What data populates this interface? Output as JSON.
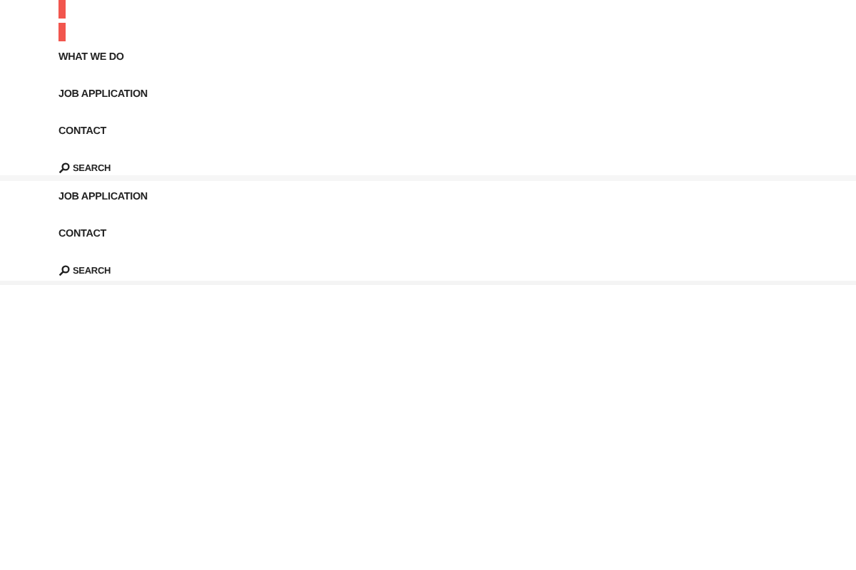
{
  "menus": [
    {
      "items": [
        "WHAT WE DO",
        "JOB APPLICATION",
        "CONTACT"
      ],
      "search": "SEARCH",
      "accent": true
    },
    {
      "items": [
        "JOB APPLICATION",
        "CONTACT"
      ],
      "search": "SEARCH",
      "accent": false
    }
  ]
}
